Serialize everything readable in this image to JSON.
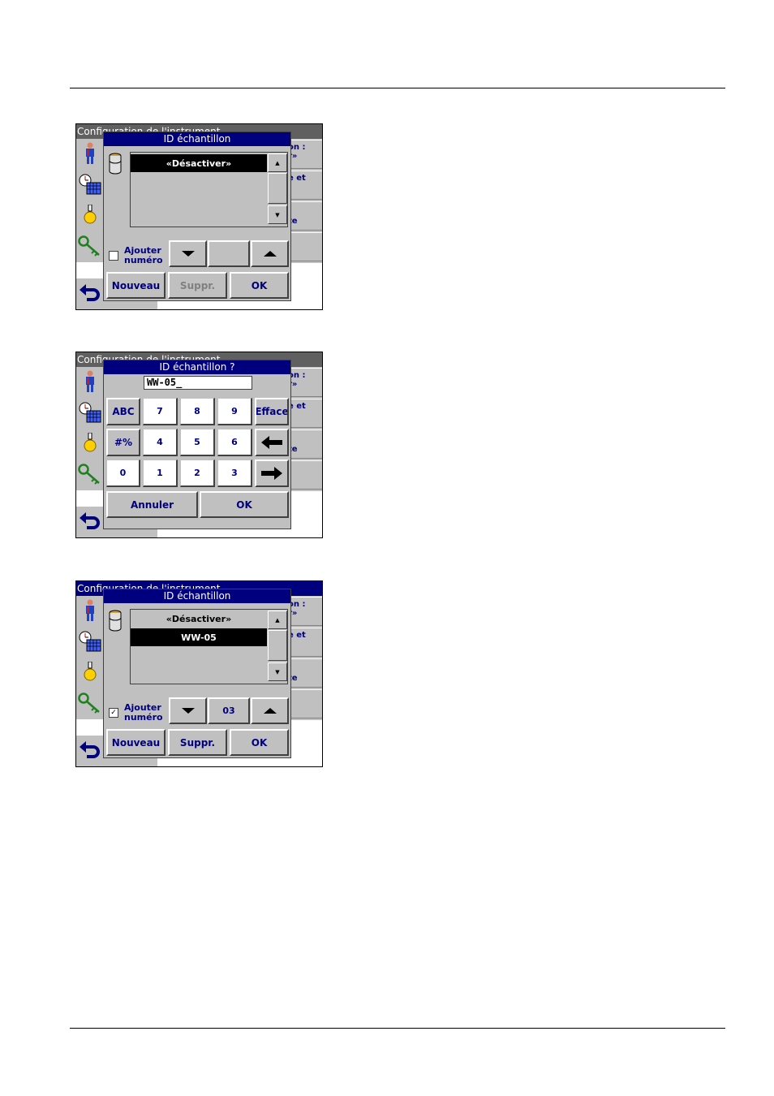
{
  "screens": [
    {
      "background_title": "Configuration de l'instrument",
      "background_buttons": [
        "on :\nr»",
        "e et",
        "te",
        ""
      ],
      "dialog": {
        "title": "ID échantillon",
        "list": [
          "«Désactiver»"
        ],
        "selected_index": 0,
        "checkbox_checked": false,
        "checkbox_label_1": "Ajouter",
        "checkbox_label_2": "numéro",
        "counter_value": "",
        "buttons": {
          "new": "Nouveau",
          "delete": "Suppr.",
          "ok": "OK"
        },
        "delete_enabled": false
      }
    },
    {
      "background_title": "Configuration de l'instrument",
      "background_buttons": [
        "on :\nr»",
        "e et",
        "te",
        ""
      ],
      "dialog": {
        "title": "ID échantillon ?",
        "entry_value": "WW-05_",
        "keys": [
          [
            "ABC",
            "7",
            "8",
            "9",
            "Efface"
          ],
          [
            "#%",
            "4",
            "5",
            "6",
            "←"
          ],
          [
            "0",
            "1",
            "2",
            "3",
            "→"
          ]
        ],
        "buttons": {
          "cancel": "Annuler",
          "ok": "OK"
        }
      }
    },
    {
      "background_title": "Configuration de l'instrument",
      "background_buttons": [
        "on :\nr»",
        "e et",
        "te",
        ""
      ],
      "dialog": {
        "title": "ID échantillon",
        "list": [
          "«Désactiver»",
          "WW-05"
        ],
        "selected_index": 1,
        "checkbox_checked": true,
        "checkbox_mark": "✓",
        "checkbox_label_1": "Ajouter",
        "checkbox_label_2": "numéro",
        "counter_value": "03",
        "buttons": {
          "new": "Nouveau",
          "delete": "Suppr.",
          "ok": "OK"
        },
        "delete_enabled": true
      }
    }
  ],
  "colors": {
    "navy": "#00007f",
    "panel": "#c0c0c0",
    "header_gray": "#606060"
  },
  "icons": [
    "person-icon",
    "clock-calendar-icon",
    "lamp-icon",
    "key-icon",
    "back-arrow-icon",
    "sample-vial-icon"
  ]
}
